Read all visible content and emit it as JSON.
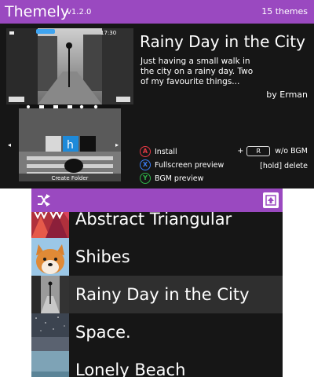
{
  "app": {
    "title": "Themely",
    "version": "v1.2.0",
    "theme_count": "15 themes"
  },
  "preview": {
    "status_text": "17:30",
    "folder_label": "Create Folder"
  },
  "selected_theme": {
    "name": "Rainy Day in the City",
    "description": "Just having a small walk in the city on a rainy day. Two of my favourite things...",
    "author": "by Erman"
  },
  "controls": {
    "install": {
      "key": "A",
      "label": "Install"
    },
    "fullscreen": {
      "key": "X",
      "label": "Fullscreen preview"
    },
    "bgm_preview": {
      "key": "Y",
      "label": "BGM preview"
    },
    "without_bgm": {
      "prefix": "+",
      "key": "R",
      "label": "w/o BGM"
    },
    "delete": {
      "label": "[hold] delete"
    }
  },
  "theme_list": [
    {
      "name": "Abstract Triangular",
      "icon": "abstract-triangular-thumbnail"
    },
    {
      "name": "Shibes",
      "icon": "shibe-dog-thumbnail"
    },
    {
      "name": "Rainy Day in the City",
      "icon": "rainy-city-thumbnail",
      "selected": true
    },
    {
      "name": "Space.",
      "icon": "starry-space-thumbnail"
    },
    {
      "name": "Lonely Beach",
      "icon": "beach-thumbnail"
    }
  ],
  "colors": {
    "accent": "#9a49c0",
    "background": "#161616",
    "selected_row": "#2f2f2f",
    "button_a": "#e53945",
    "button_x": "#3a7cf0",
    "button_y": "#2fb34a"
  }
}
